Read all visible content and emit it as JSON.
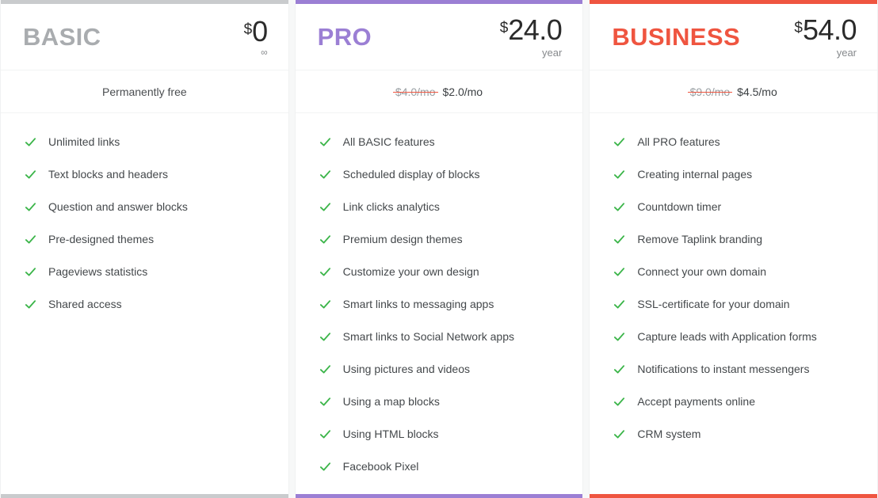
{
  "colors": {
    "basic_accent": "#c9cbcd",
    "pro_accent": "#9b7fd4",
    "business_accent": "#ef5540",
    "check_green": "#3cb54a",
    "strike_red": "#ef5540",
    "page_background": "#f7f8f8",
    "card_background": "#ffffff"
  },
  "plans": [
    {
      "name": "BASIC",
      "name_color": "#a9acaf",
      "accent_color": "#c9cbcd",
      "currency": "$",
      "amount": "0",
      "period": "∞",
      "period_is_infinity": true,
      "subtitle_plain": "Permanently free",
      "has_discount": false,
      "old_price": "",
      "new_price": "",
      "check_icon": "check-icon",
      "features": [
        "Unlimited links",
        "Text blocks and headers",
        "Question and answer blocks",
        "Pre-designed themes",
        "Pageviews statistics",
        "Shared access"
      ]
    },
    {
      "name": "PRO",
      "name_color": "#9b7fd4",
      "accent_color": "#9b7fd4",
      "currency": "$",
      "amount": "24.0",
      "period": "year",
      "period_is_infinity": false,
      "subtitle_plain": "",
      "has_discount": true,
      "old_price": "$4.0/mo",
      "new_price": "$2.0/mo",
      "check_icon": "check-icon",
      "features": [
        "All BASIC features",
        "Scheduled display of blocks",
        "Link clicks analytics",
        "Premium design themes",
        "Customize your own design",
        "Smart links to messaging apps",
        "Smart links to Social Network apps",
        "Using pictures and videos",
        "Using a map blocks",
        "Using HTML blocks",
        "Facebook Pixel"
      ]
    },
    {
      "name": "BUSINESS",
      "name_color": "#ef5540",
      "accent_color": "#ef5540",
      "currency": "$",
      "amount": "54.0",
      "period": "year",
      "period_is_infinity": false,
      "subtitle_plain": "",
      "has_discount": true,
      "old_price": "$9.0/mo",
      "new_price": "$4.5/mo",
      "check_icon": "check-icon",
      "features": [
        "All PRO features",
        "Creating internal pages",
        "Countdown timer",
        "Remove Taplink branding",
        "Connect your own domain",
        "SSL-certificate for your domain",
        "Capture leads with Application forms",
        "Notifications to instant messengers",
        "Accept payments online",
        "CRM system"
      ]
    }
  ]
}
